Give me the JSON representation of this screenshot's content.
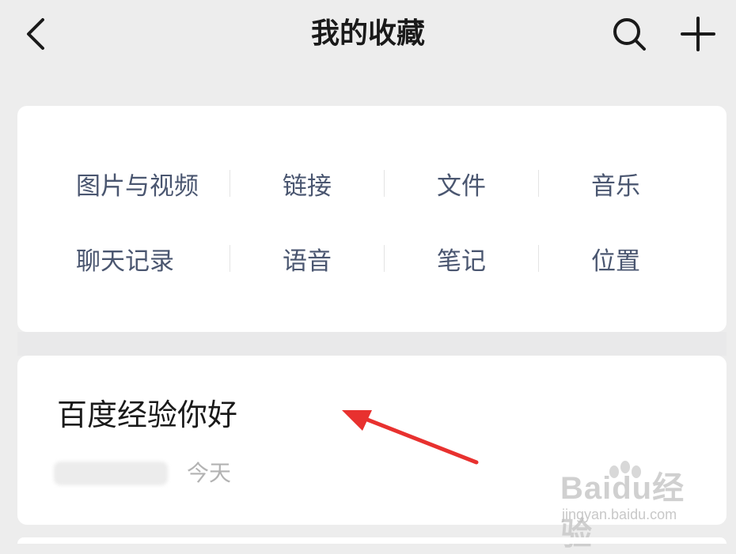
{
  "header": {
    "title": "我的收藏"
  },
  "categories": {
    "row1": [
      "图片与视频",
      "链接",
      "文件",
      "音乐"
    ],
    "row2": [
      "聊天记录",
      "语音",
      "笔记",
      "位置"
    ]
  },
  "favorite": {
    "title": "百度经验你好",
    "time": "今天"
  },
  "watermark": {
    "brand": "Baidu经验",
    "url": "jingyan.baidu.com"
  },
  "colors": {
    "background": "#ededed",
    "card": "#ffffff",
    "category_text": "#4a5670",
    "arrow": "#e8312f"
  }
}
